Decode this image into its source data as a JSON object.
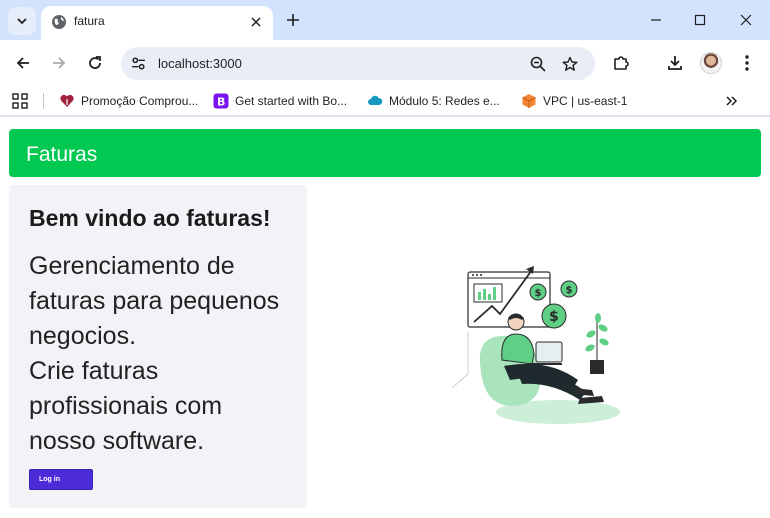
{
  "browser": {
    "tab": {
      "title": "fatura",
      "favicon": "globe-icon"
    },
    "address_bar": {
      "url": "localhost:3000"
    },
    "bookmarks": [
      {
        "label": "Promoção Comprou...",
        "icon": "heart-icon"
      },
      {
        "label": "Get started with Bo...",
        "icon": "bootstrap-icon"
      },
      {
        "label": "Módulo 5: Redes e...",
        "icon": "cloud-icon"
      },
      {
        "label": "VPC | us-east-1",
        "icon": "aws-cube-icon"
      }
    ]
  },
  "app": {
    "brand": "Faturas",
    "brand_color": "#00c851",
    "welcome": {
      "title": "Bem vindo ao faturas!",
      "lead_lines": [
        "Gerenciamento de",
        "faturas para pequenos",
        "negocios.",
        "Crie faturas",
        "profissionais com",
        "nosso software."
      ],
      "login_button": "Log in",
      "login_color": "#4c2bd8"
    },
    "hero_illustration": "person-with-laptop-finance-illustration"
  }
}
